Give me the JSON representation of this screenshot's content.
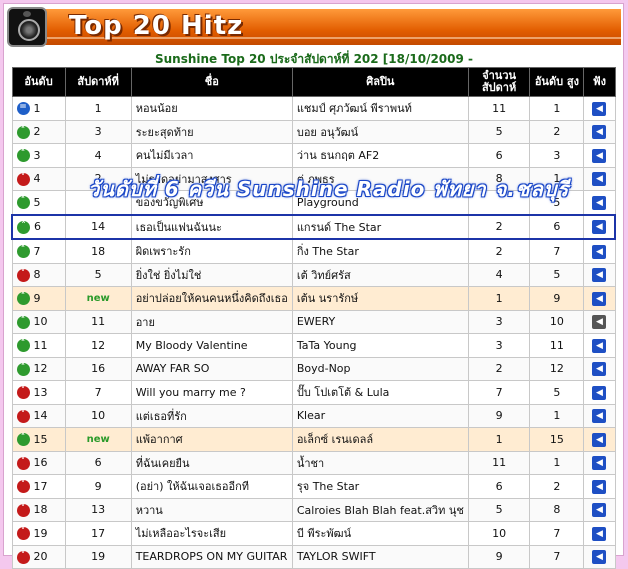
{
  "header": {
    "title": "Top 20 Hitz"
  },
  "subtitle": "Sunshine Top 20 ประจำสัปดาห์ที่ 202 [18/10/2009 -",
  "columns": {
    "rank": "อันดับ",
    "prev": "สัปดาห์ที่",
    "song": "ชื่อ",
    "artist": "ศิลปิน",
    "weeks": "จำนวน สัปดาห์",
    "peak": "อันดับ สูง",
    "listen": "ฟัง"
  },
  "overlay_text": "วันดับที่ 6 ควีน Sunshine Radio พัทยา จ.ชลบุรี",
  "rows": [
    {
      "rank": "1",
      "move": "same",
      "prev": "1",
      "song": "หอนน้อย",
      "artist": "แชมป์ ศุภวัฒน์ พีราพนท์",
      "weeks": "11",
      "peak": "1"
    },
    {
      "rank": "2",
      "move": "up",
      "prev": "3",
      "song": "ระยะสุดท้าย",
      "artist": "บอย อนุวัฒน์",
      "weeks": "5",
      "peak": "2"
    },
    {
      "rank": "3",
      "move": "up",
      "prev": "4",
      "song": "คนไม่มีเวลา",
      "artist": "ว่าน ธนกฤต AF2",
      "weeks": "6",
      "peak": "3"
    },
    {
      "rank": "4",
      "move": "down",
      "prev": "2",
      "song": "ไม่รอดอย่ามาสงสาร",
      "artist": "ตู่ ภพธร",
      "weeks": "8",
      "peak": "1"
    },
    {
      "rank": "5",
      "move": "up",
      "prev": "",
      "song": "ของขวัญพิเศษ",
      "artist": "Playground",
      "weeks": "",
      "peak": "5"
    },
    {
      "rank": "6",
      "move": "up",
      "prev": "14",
      "song": "เธอเป็นแฟนฉันนะ",
      "artist": "แกรนด์ The Star",
      "weeks": "2",
      "peak": "6"
    },
    {
      "rank": "7",
      "move": "up",
      "prev": "18",
      "song": "ผิดเพราะรัก",
      "artist": "กิ่ง The Star",
      "weeks": "2",
      "peak": "7"
    },
    {
      "rank": "8",
      "move": "down",
      "prev": "5",
      "song": "ยิ่งใช่ ยิ่งไม่ใช่",
      "artist": "เต้ วิทย์ศรัส",
      "weeks": "4",
      "peak": "5"
    },
    {
      "rank": "9",
      "move": "up",
      "prev": "new",
      "song": "อย่าปล่อยให้คนคนหนึ่งคิดถึงเธอ",
      "artist": "เต้น นรารักษ์",
      "weeks": "1",
      "peak": "9"
    },
    {
      "rank": "10",
      "move": "up",
      "prev": "11",
      "song": "อาย",
      "artist": "EWERY",
      "weeks": "3",
      "peak": "10"
    },
    {
      "rank": "11",
      "move": "up",
      "prev": "12",
      "song": "My Bloody Valentine",
      "artist": "TaTa Young",
      "weeks": "3",
      "peak": "11"
    },
    {
      "rank": "12",
      "move": "up",
      "prev": "16",
      "song": "AWAY FAR SO",
      "artist": "Boyd-Nop",
      "weeks": "2",
      "peak": "12"
    },
    {
      "rank": "13",
      "move": "down",
      "prev": "7",
      "song": "Will you marry me ?",
      "artist": "ปั๊บ โปเตโต้ & Lula",
      "weeks": "7",
      "peak": "5"
    },
    {
      "rank": "14",
      "move": "down",
      "prev": "10",
      "song": "แต่เธอที่รัก",
      "artist": "Klear",
      "weeks": "9",
      "peak": "1"
    },
    {
      "rank": "15",
      "move": "up",
      "prev": "new",
      "song": "แพ้อากาศ",
      "artist": "อเล็กซ์ เรนเดลล์",
      "weeks": "1",
      "peak": "15"
    },
    {
      "rank": "16",
      "move": "down",
      "prev": "6",
      "song": "ที่ฉันเคยยืน",
      "artist": "น้ำชา",
      "weeks": "11",
      "peak": "1"
    },
    {
      "rank": "17",
      "move": "down",
      "prev": "9",
      "song": "(อย่า) ให้ฉันเจอเธออีกที",
      "artist": "รุจ The Star",
      "weeks": "6",
      "peak": "2"
    },
    {
      "rank": "18",
      "move": "down",
      "prev": "13",
      "song": "หวาน",
      "artist": "Calroies Blah Blah feat.สวิท นุช",
      "weeks": "5",
      "peak": "8"
    },
    {
      "rank": "19",
      "move": "down",
      "prev": "17",
      "song": "ไม่เหลืออะไรจะเสีย",
      "artist": "บี พีระพัฒน์",
      "weeks": "10",
      "peak": "7"
    },
    {
      "rank": "20",
      "move": "down",
      "prev": "19",
      "song": "TEARDROPS ON MY GUITAR",
      "artist": "TAYLOR SWIFT",
      "weeks": "9",
      "peak": "7"
    }
  ],
  "colors": {
    "header_orange": "#e25d00",
    "up": "#2e9a2e",
    "down": "#c41a1a",
    "same": "#1e5fc8",
    "highlight_border": "#1c34a8"
  },
  "icons": {
    "up": "up-arrow-icon",
    "down": "down-arrow-icon",
    "same": "equal-icon",
    "listen": "speaker-icon"
  }
}
